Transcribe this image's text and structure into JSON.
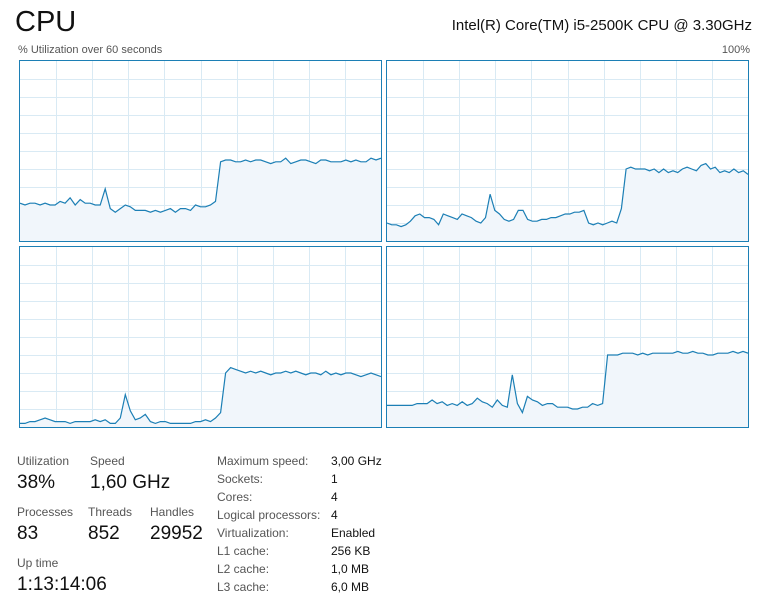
{
  "header": {
    "title": "CPU",
    "processor_name": "Intel(R) Core(TM) i5-2500K CPU @ 3.30GHz",
    "utilization_caption": "% Utilization over 60 seconds",
    "max_caption": "100%"
  },
  "graphs": {
    "line_color": "#1c7fb5",
    "fill_color": "#f1f6fb",
    "grid_color": "#d9eaf4",
    "y_range": [
      0,
      100
    ],
    "cores": [
      {
        "core": 0,
        "utilization_percent": [
          21,
          20,
          21,
          21,
          20,
          21,
          20,
          20,
          22,
          21,
          24,
          20,
          23,
          21,
          21,
          20,
          20,
          29,
          18,
          16,
          18,
          20,
          19,
          17,
          17,
          17,
          16,
          17,
          16,
          17,
          18,
          16,
          18,
          18,
          17,
          20,
          19,
          19,
          20,
          22,
          44,
          45,
          45,
          44,
          44,
          45,
          44,
          45,
          45,
          44,
          43,
          44,
          44,
          46,
          43,
          44,
          45,
          45,
          44,
          43,
          45,
          45,
          44,
          44,
          44,
          45,
          44,
          45,
          44,
          44,
          46,
          45,
          46
        ]
      },
      {
        "core": 1,
        "utilization_percent": [
          10,
          9,
          9,
          8,
          9,
          11,
          14,
          15,
          13,
          13,
          12,
          9,
          15,
          14,
          13,
          12,
          15,
          14,
          13,
          11,
          10,
          13,
          26,
          17,
          15,
          12,
          11,
          12,
          17,
          17,
          12,
          11,
          11,
          12,
          12,
          13,
          13,
          14,
          15,
          15,
          16,
          16,
          17,
          10,
          9,
          10,
          9,
          10,
          11,
          10,
          18,
          40,
          41,
          40,
          40,
          40,
          39,
          40,
          38,
          40,
          38,
          39,
          38,
          40,
          41,
          40,
          39,
          42,
          43,
          40,
          41,
          38,
          39,
          38,
          40,
          38,
          39,
          37
        ]
      },
      {
        "core": 2,
        "utilization_percent": [
          2,
          2,
          3,
          3,
          4,
          5,
          4,
          3,
          3,
          3,
          2,
          3,
          3,
          3,
          3,
          4,
          3,
          4,
          2,
          2,
          5,
          18,
          9,
          4,
          5,
          7,
          3,
          2,
          3,
          3,
          2,
          2,
          2,
          2,
          2,
          3,
          3,
          4,
          3,
          5,
          8,
          30,
          33,
          32,
          31,
          30,
          31,
          30,
          31,
          30,
          29,
          30,
          30,
          31,
          30,
          31,
          30,
          29,
          30,
          30,
          29,
          31,
          29,
          30,
          29,
          30,
          30,
          29,
          28,
          29,
          30,
          29,
          28
        ]
      },
      {
        "core": 3,
        "utilization_percent": [
          12,
          12,
          12,
          12,
          12,
          12,
          13,
          13,
          13,
          15,
          13,
          14,
          12,
          13,
          12,
          14,
          12,
          13,
          16,
          14,
          13,
          11,
          15,
          12,
          11,
          29,
          13,
          8,
          17,
          15,
          14,
          12,
          13,
          13,
          11,
          11,
          11,
          10,
          10,
          11,
          11,
          13,
          12,
          13,
          40,
          40,
          40,
          41,
          41,
          41,
          40,
          41,
          40,
          41,
          41,
          41,
          41,
          41,
          42,
          41,
          41,
          42,
          41,
          41,
          40,
          40,
          41,
          41,
          41,
          42,
          41,
          42,
          41
        ]
      }
    ]
  },
  "stats": {
    "utilization_label": "Utilization",
    "utilization_value": "38%",
    "speed_label": "Speed",
    "speed_value": "1,60 GHz",
    "processes_label": "Processes",
    "processes_value": "83",
    "threads_label": "Threads",
    "threads_value": "852",
    "handles_label": "Handles",
    "handles_value": "29952",
    "uptime_label": "Up time",
    "uptime_value": "1:13:14:06"
  },
  "specs": [
    {
      "label": "Maximum speed:",
      "value": "3,00 GHz"
    },
    {
      "label": "Sockets:",
      "value": "1"
    },
    {
      "label": "Cores:",
      "value": "4"
    },
    {
      "label": "Logical processors:",
      "value": "4"
    },
    {
      "label": "Virtualization:",
      "value": "Enabled"
    },
    {
      "label": "L1 cache:",
      "value": "256 KB"
    },
    {
      "label": "L2 cache:",
      "value": "1,0 MB"
    },
    {
      "label": "L3 cache:",
      "value": "6,0 MB"
    }
  ]
}
